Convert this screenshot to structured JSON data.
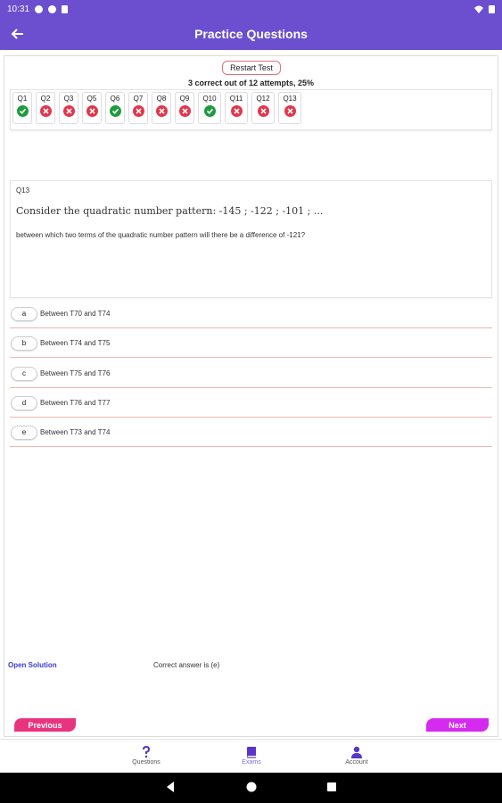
{
  "status_bar": {
    "time": "10:31"
  },
  "app_bar": {
    "title": "Practice Questions"
  },
  "restart_label": "Restart Test",
  "score_text": "3 correct out of 12 attempts, 25%",
  "questions": [
    {
      "label": "Q1",
      "status": "correct"
    },
    {
      "label": "Q2",
      "status": "wrong"
    },
    {
      "label": "Q3",
      "status": "wrong"
    },
    {
      "label": "Q5",
      "status": "wrong"
    },
    {
      "label": "Q6",
      "status": "correct"
    },
    {
      "label": "Q7",
      "status": "wrong"
    },
    {
      "label": "Q8",
      "status": "wrong"
    },
    {
      "label": "Q9",
      "status": "wrong"
    },
    {
      "label": "Q10",
      "status": "correct"
    },
    {
      "label": "Q11",
      "status": "wrong"
    },
    {
      "label": "Q12",
      "status": "wrong"
    },
    {
      "label": "Q13",
      "status": "wrong"
    }
  ],
  "question": {
    "number": "Q13",
    "text": "Consider the quadratic number pattern: -145 ; -122 ; -101 ; ...",
    "subtext": "between which two terms of the quadratic number pattern will there be a difference of -121?"
  },
  "options": [
    {
      "letter": "a",
      "text": "Between T70 and T74"
    },
    {
      "letter": "b",
      "text": "Between T74 and T75"
    },
    {
      "letter": "c",
      "text": "Between T75 and T76"
    },
    {
      "letter": "d",
      "text": "Between T76 and T77"
    },
    {
      "letter": "e",
      "text": "Between T73 and T74"
    }
  ],
  "open_solution": "Open Solution",
  "correct_answer": "Correct answer is (e)",
  "previous_label": "Previous",
  "next_label": "Next",
  "bottom_nav": [
    {
      "label": "Questions",
      "icon": "question-icon",
      "color": "#5b35c9"
    },
    {
      "label": "Exams",
      "icon": "book-icon",
      "color": "#5b35c9"
    },
    {
      "label": "Account",
      "icon": "person-icon",
      "color": "#5b35c9"
    }
  ],
  "colors": {
    "primary": "#6b4fcf",
    "correct": "#1e9b3c",
    "wrong": "#e2364a",
    "prev": "#e8347f",
    "next": "#d52bf0"
  }
}
